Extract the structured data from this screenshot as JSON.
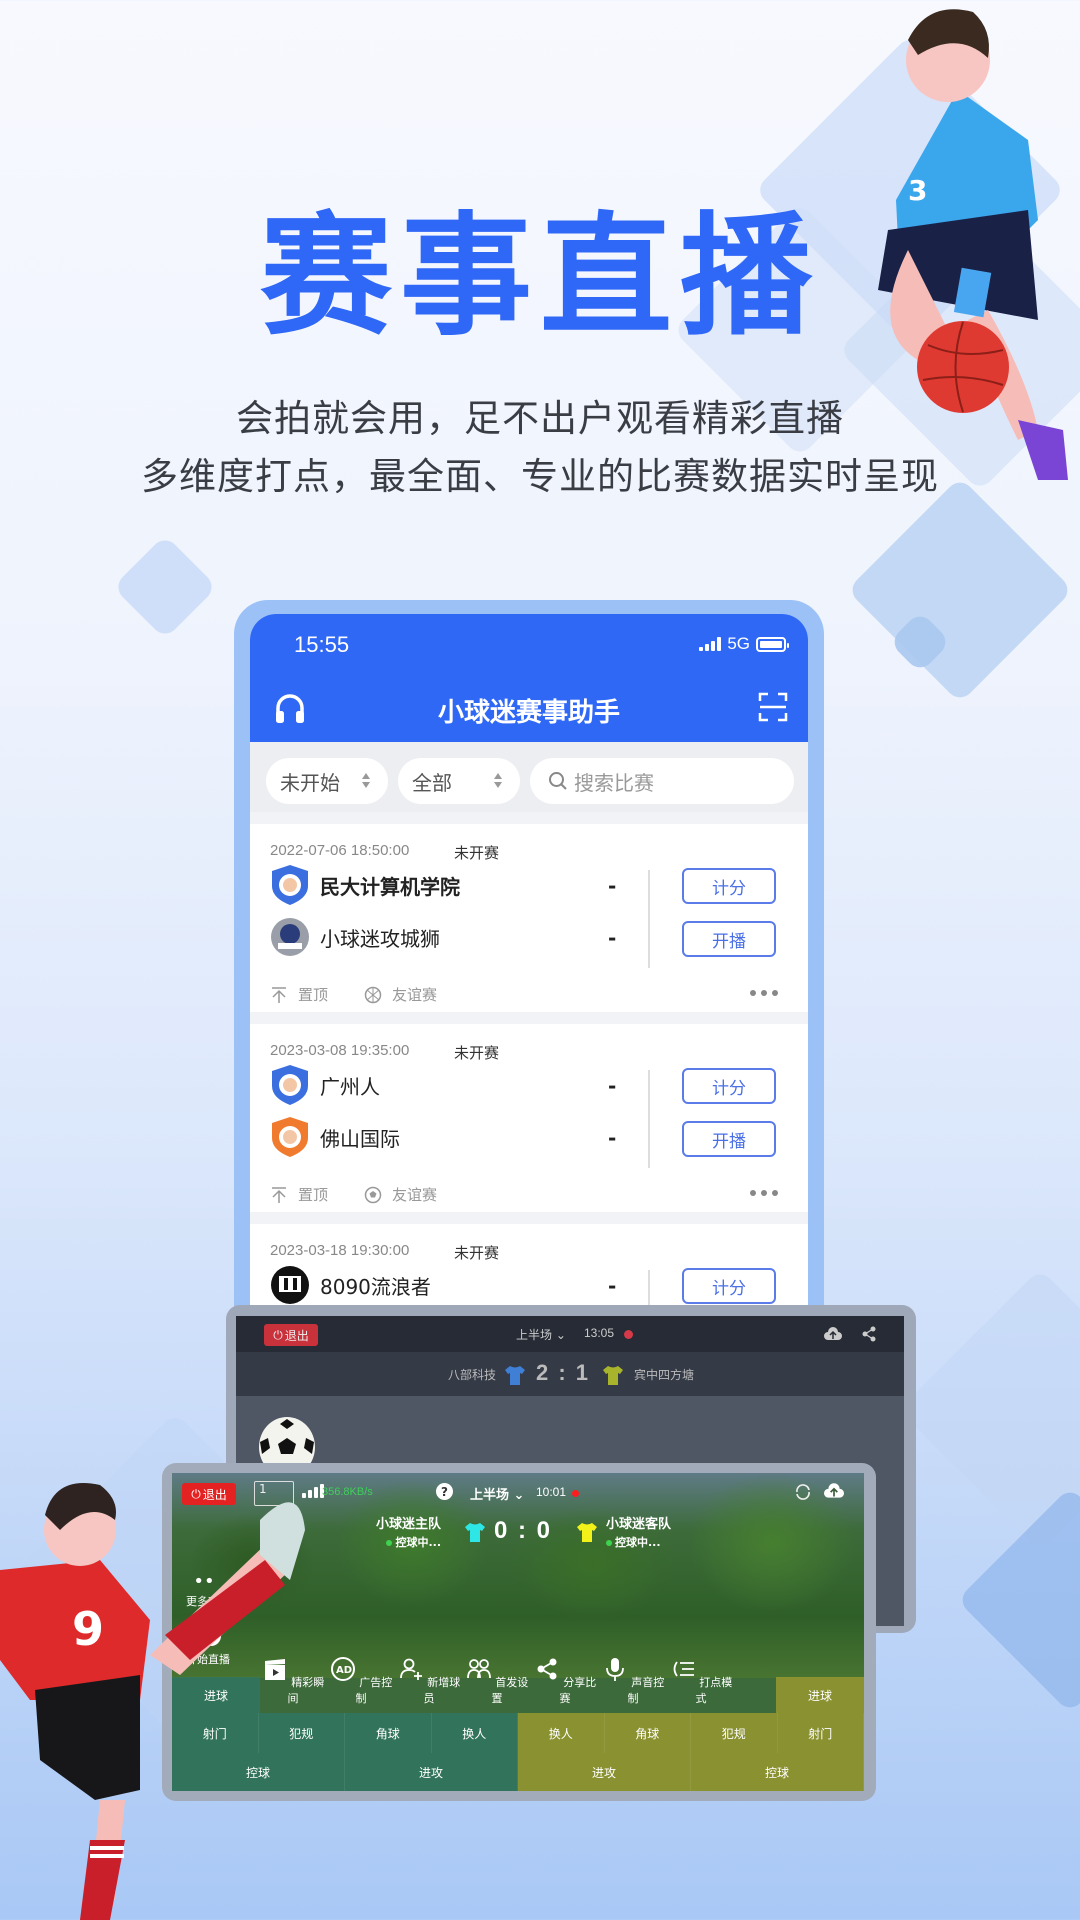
{
  "promo": {
    "headline": "赛事直播",
    "subline1": "会拍就会用，足不出户观看精彩直播",
    "subline2": "多维度打点，最全面、专业的比赛数据实时呈现",
    "brand_color": "#2f67f6"
  },
  "phone": {
    "status": {
      "time": "15:55",
      "network": "5G"
    },
    "header": {
      "title": "小球迷赛事助手",
      "left_icon": "headphones-icon",
      "right_icon": "scan-icon"
    },
    "filters": {
      "status_select": "未开始",
      "category_select": "全部",
      "search_placeholder": "搜索比赛"
    },
    "matches": [
      {
        "datetime": "2022-07-06 18:50:00",
        "state": "未开赛",
        "home": {
          "name": "民大计算机学院",
          "score": "-",
          "badge": "blue-shield"
        },
        "away": {
          "name": "小球迷攻城狮",
          "score": "-",
          "badge": "round-avatar"
        },
        "score_button": "计分",
        "live_button": "开播",
        "pin_label": "置顶",
        "type_label": "友谊赛",
        "sport_icon": "basketball-icon"
      },
      {
        "datetime": "2023-03-08 19:35:00",
        "state": "未开赛",
        "home": {
          "name": "广州人",
          "score": "-",
          "badge": "blue-shield"
        },
        "away": {
          "name": "佛山国际",
          "score": "-",
          "badge": "orange-shield"
        },
        "score_button": "计分",
        "live_button": "开播",
        "pin_label": "置顶",
        "type_label": "友谊赛",
        "sport_icon": "football-icon"
      },
      {
        "datetime": "2023-03-18 19:30:00",
        "state": "未开赛",
        "home": {
          "name": "8090流浪者",
          "score": "-",
          "badge": "black-round"
        },
        "score_button": "计分"
      }
    ]
  },
  "tablet_basketball": {
    "exit_label": "退出",
    "period": "上半场",
    "clock": "13:05",
    "home_team": "八部科技",
    "score": "2 : 1",
    "away_team": "宾中四方塘",
    "home_shirt_color": "#3f7fd6",
    "away_shirt_color": "#a8b52c"
  },
  "tablet_football": {
    "exit_label": "退出",
    "box_text": "1",
    "net_speed": "356.8KB/s",
    "period": "上半场",
    "clock": "10:01",
    "home_team": "小球迷主队",
    "home_status": "控球中...",
    "score": "0 : 0",
    "away_team": "小球迷客队",
    "away_status": "控球中...",
    "home_shirt_color": "#2ee6e6",
    "away_shirt_color": "#f2f21a",
    "more_label": "更多功能",
    "start_live_label": "开始直播",
    "tools": [
      "精彩瞬间",
      "广告控制",
      "新增球员",
      "首发设置",
      "分享比赛",
      "声音控制",
      "打点模式"
    ],
    "goal_left": "进球",
    "goal_right": "进球",
    "row1_left": [
      "射门",
      "犯规",
      "角球",
      "换人"
    ],
    "row1_right": [
      "换人",
      "角球",
      "犯规",
      "射门"
    ],
    "row2_left": [
      "控球",
      "进攻"
    ],
    "row2_right": [
      "进攻",
      "控球"
    ]
  }
}
